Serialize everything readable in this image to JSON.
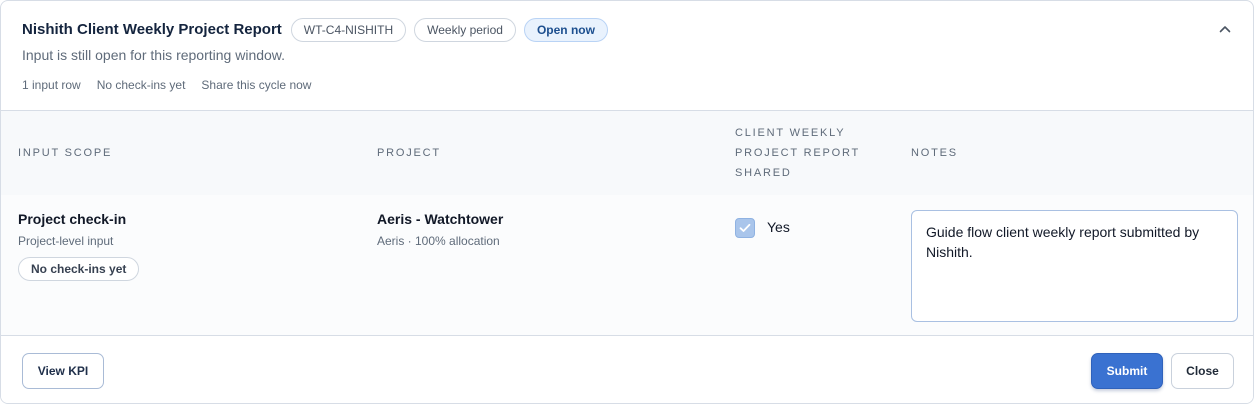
{
  "header": {
    "title": "Nishith Client Weekly Project Report",
    "chips": [
      "WT-C4-NISHITH",
      "Weekly period"
    ],
    "status_chip": "Open now",
    "subtitle": "Input is still open for this reporting window.",
    "meta": [
      "1 input row",
      "No check-ins yet",
      "Share this cycle now"
    ],
    "collapse_icon": "chevron-up-icon"
  },
  "table": {
    "columns": {
      "scope": "Input Scope",
      "project": "Project",
      "shared_line1": "Client Weekly",
      "shared_line2": "Project Report",
      "shared_line3": "Shared",
      "notes": "Notes"
    },
    "row": {
      "scope_title": "Project check-in",
      "scope_sub": "Project-level input",
      "scope_badge": "No check-ins yet",
      "project_title": "Aeris - Watchtower",
      "project_sub": "Aeris · 100% allocation",
      "shared_checked": true,
      "shared_label": "Yes",
      "notes_value": "Guide flow client weekly report submitted by Nishith."
    }
  },
  "footer": {
    "view_kpi": "View KPI",
    "submit": "Submit",
    "close": "Close"
  },
  "colors": {
    "accent": "#3a72d1",
    "title": "#14243e",
    "open_chip_bg": "#e9f2fd"
  }
}
